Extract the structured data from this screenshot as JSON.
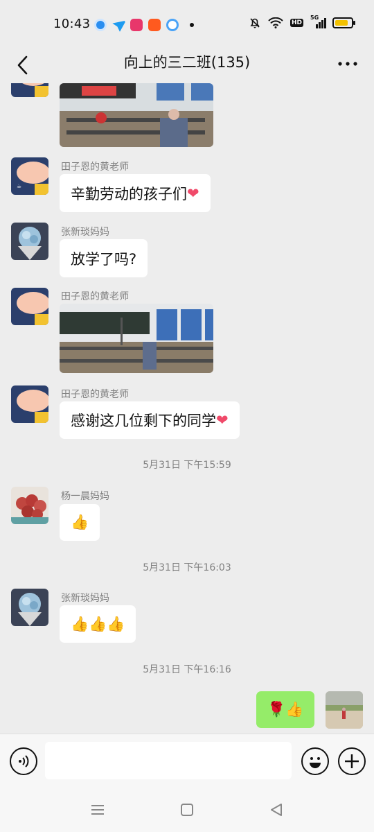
{
  "status": {
    "time": "10:43",
    "network": "5G"
  },
  "header": {
    "title": "向上的三二班(135)"
  },
  "messages": {
    "m1": {
      "sender": "田子恩的黄老师",
      "text": "辛勤劳动的孩子们"
    },
    "m2": {
      "sender": "张新琰妈妈",
      "text": "放学了吗?"
    },
    "m3": {
      "sender": "田子恩的黄老师"
    },
    "m4": {
      "sender": "田子恩的黄老师",
      "text": "感谢这几位剩下的同学"
    },
    "ts1": "5月31日 下午15:59",
    "m5": {
      "sender": "杨一晨妈妈",
      "text": "👍"
    },
    "ts2": "5月31日 下午16:03",
    "m6": {
      "sender": "张新琰妈妈",
      "text": "👍👍👍"
    },
    "ts3": "5月31日 下午16:16",
    "m7": {
      "text": "🌹👍"
    }
  },
  "colors": {
    "my_bubble": "#95ec69",
    "bubble": "#ffffff",
    "background": "#ededed"
  },
  "icons": [
    "back-icon",
    "more-icon",
    "voice-icon",
    "emoji-icon",
    "plus-icon",
    "heart-emoji",
    "thumbs-up-emoji",
    "rose-emoji"
  ]
}
